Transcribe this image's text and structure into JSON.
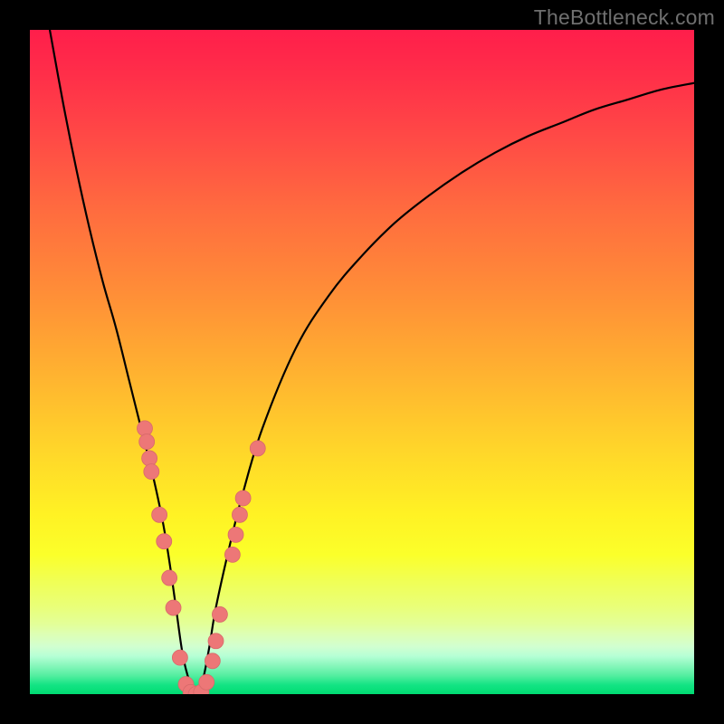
{
  "watermark": "TheBottleneck.com",
  "colors": {
    "frame": "#000000",
    "curve_stroke": "#000000",
    "dot_fill": "#ed7777",
    "dot_stroke": "#d86a6a"
  },
  "chart_data": {
    "type": "line",
    "title": "",
    "xlabel": "",
    "ylabel": "",
    "xlim": [
      0,
      100
    ],
    "ylim": [
      0,
      100
    ],
    "series": [
      {
        "name": "bottleneck-curve",
        "x": [
          3,
          5,
          7,
          9,
          11,
          13,
          15,
          17,
          18.5,
          20,
          21,
          22,
          23,
          24,
          25,
          26,
          27,
          28,
          30,
          32,
          35,
          40,
          45,
          50,
          55,
          60,
          65,
          70,
          75,
          80,
          85,
          90,
          95,
          100
        ],
        "y": [
          100,
          89,
          79,
          70,
          62,
          55,
          47,
          39,
          33,
          26,
          20,
          13,
          6,
          2,
          0,
          2,
          7,
          13,
          22,
          30,
          40,
          52,
          60,
          66,
          71,
          75,
          78.5,
          81.5,
          84,
          86,
          88,
          89.5,
          91,
          92
        ]
      }
    ],
    "scatter_points": {
      "name": "sample-dots",
      "points": [
        {
          "x": 17.3,
          "y": 40
        },
        {
          "x": 17.6,
          "y": 38
        },
        {
          "x": 18.0,
          "y": 35.5
        },
        {
          "x": 18.3,
          "y": 33.5
        },
        {
          "x": 19.5,
          "y": 27
        },
        {
          "x": 20.2,
          "y": 23
        },
        {
          "x": 21.0,
          "y": 17.5
        },
        {
          "x": 21.6,
          "y": 13
        },
        {
          "x": 22.6,
          "y": 5.5
        },
        {
          "x": 23.5,
          "y": 1.5
        },
        {
          "x": 24.2,
          "y": 0.3
        },
        {
          "x": 25.0,
          "y": 0
        },
        {
          "x": 25.8,
          "y": 0.3
        },
        {
          "x": 26.6,
          "y": 1.8
        },
        {
          "x": 27.5,
          "y": 5
        },
        {
          "x": 28.0,
          "y": 8
        },
        {
          "x": 28.6,
          "y": 12
        },
        {
          "x": 30.5,
          "y": 21
        },
        {
          "x": 31.0,
          "y": 24
        },
        {
          "x": 31.6,
          "y": 27
        },
        {
          "x": 32.1,
          "y": 29.5
        },
        {
          "x": 34.3,
          "y": 37
        }
      ]
    }
  }
}
